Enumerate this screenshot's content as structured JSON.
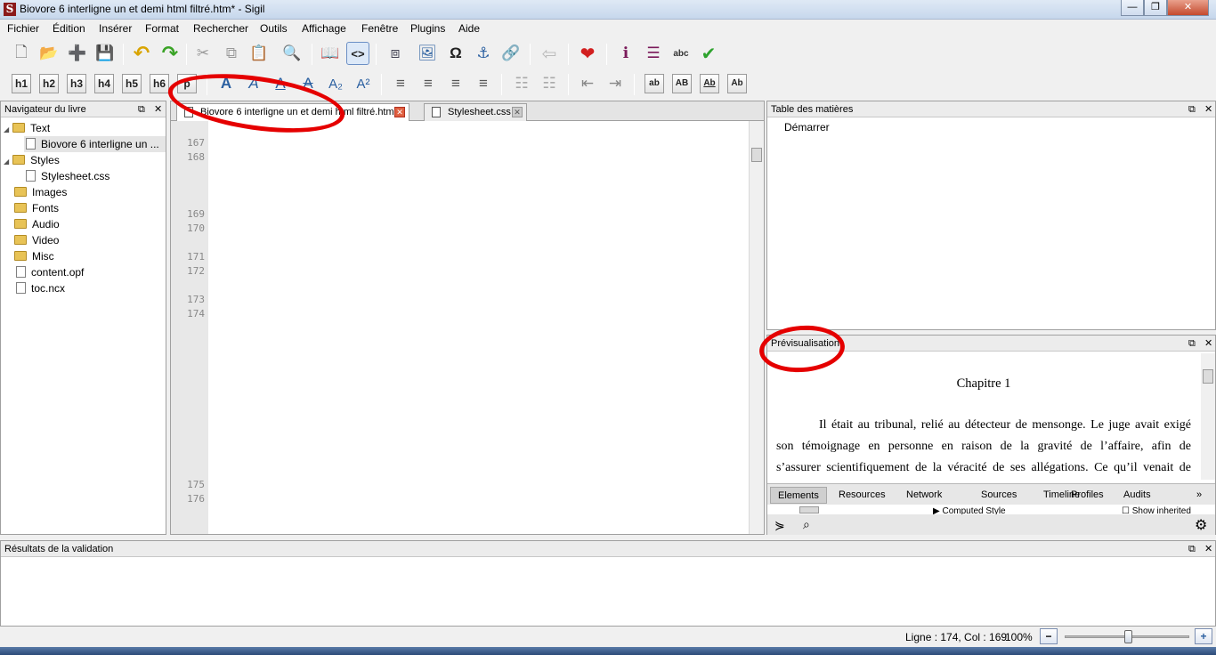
{
  "window": {
    "title": "Biovore 6 interligne un et demi html filtré.htm* - Sigil",
    "app_icon": "S",
    "buttons": {
      "minimize": "—",
      "maximize": "❐",
      "close": "✕"
    }
  },
  "menu": [
    "Fichier",
    "Édition",
    "Insérer",
    "Format",
    "Rechercher",
    "Outils",
    "Affichage",
    "Fenêtre",
    "Plugins",
    "Aide"
  ],
  "toolbar1": [
    {
      "name": "new-file-icon",
      "glyph": "🗋"
    },
    {
      "name": "open-folder-icon",
      "glyph": "📂"
    },
    {
      "name": "add-file-icon",
      "glyph": "➕"
    },
    {
      "name": "save-icon",
      "glyph": "💾"
    },
    {
      "name": "undo-icon",
      "glyph": "↶"
    },
    {
      "name": "redo-icon",
      "glyph": "↷"
    },
    {
      "name": "cut-icon",
      "glyph": "✂"
    },
    {
      "name": "copy-icon",
      "glyph": "⧉"
    },
    {
      "name": "paste-icon",
      "glyph": "📋"
    },
    {
      "name": "find-icon",
      "glyph": "🔍"
    },
    {
      "name": "book-view-icon",
      "glyph": "📖"
    },
    {
      "name": "code-view-icon",
      "glyph": "<>"
    },
    {
      "name": "split-icon",
      "glyph": "⧈"
    },
    {
      "name": "insert-image-icon",
      "glyph": "🖼"
    },
    {
      "name": "omega-icon",
      "glyph": "Ω"
    },
    {
      "name": "anchor-icon",
      "glyph": "⚓"
    },
    {
      "name": "link-icon",
      "glyph": "🔗"
    },
    {
      "name": "back-arrow-icon",
      "glyph": "⇦"
    },
    {
      "name": "heart-icon",
      "glyph": "❤"
    },
    {
      "name": "metadata-icon",
      "glyph": "ℹ"
    },
    {
      "name": "toc-icon",
      "glyph": "☰"
    },
    {
      "name": "spellcheck-icon",
      "glyph": "abc"
    },
    {
      "name": "validate-icon",
      "glyph": "✔"
    }
  ],
  "heading_buttons": [
    "h1",
    "h2",
    "h3",
    "h4",
    "h5",
    "h6",
    "p"
  ],
  "toolbar2": [
    {
      "name": "bold-icon",
      "glyph": "A"
    },
    {
      "name": "italic-icon",
      "glyph": "A"
    },
    {
      "name": "underline-icon",
      "glyph": "A"
    },
    {
      "name": "strike-icon",
      "glyph": "A"
    },
    {
      "name": "subscript-icon",
      "glyph": "A₂"
    },
    {
      "name": "superscript-icon",
      "glyph": "A²"
    },
    {
      "name": "align-left-icon",
      "glyph": "≡"
    },
    {
      "name": "align-center-icon",
      "glyph": "≡"
    },
    {
      "name": "align-right-icon",
      "glyph": "≡"
    },
    {
      "name": "justify-icon",
      "glyph": "≡"
    },
    {
      "name": "bullet-list-icon",
      "glyph": "☷"
    },
    {
      "name": "number-list-icon",
      "glyph": "☷"
    },
    {
      "name": "outdent-icon",
      "glyph": "⇤"
    },
    {
      "name": "indent-icon",
      "glyph": "⇥"
    },
    {
      "name": "lowercase-icon",
      "glyph": "ab"
    },
    {
      "name": "uppercase-icon",
      "glyph": "AB"
    },
    {
      "name": "titlecase-icon",
      "glyph": "Ab"
    },
    {
      "name": "capitalize-icon",
      "glyph": "Ab"
    }
  ],
  "navigator": {
    "title": "Navigateur du livre",
    "items": [
      {
        "label": "Text",
        "type": "folder",
        "expander": "◢"
      },
      {
        "label": "Biovore 6 interligne un ...",
        "type": "file",
        "selected": true
      },
      {
        "label": "Styles",
        "type": "folder",
        "expander": "◢"
      },
      {
        "label": "Stylesheet.css",
        "type": "file"
      },
      {
        "label": "Images",
        "type": "folder"
      },
      {
        "label": "Fonts",
        "type": "folder"
      },
      {
        "label": "Audio",
        "type": "folder"
      },
      {
        "label": "Video",
        "type": "folder"
      },
      {
        "label": "Misc",
        "type": "folder"
      },
      {
        "label": "content.opf",
        "type": "file"
      },
      {
        "label": "toc.ncx",
        "type": "file"
      }
    ]
  },
  "editor": {
    "tabs": [
      {
        "label": "Biovore 6 interligne un et demi html filtré.htm",
        "active": true
      },
      {
        "label": "Stylesheet.css",
        "active": false
      }
    ],
    "line_numbers": [
      "167",
      "168",
      "169",
      "170",
      "171",
      "172",
      "173",
      "174",
      "175",
      "176"
    ]
  },
  "toc": {
    "title": "Table des matières",
    "items": [
      "Démarrer"
    ]
  },
  "preview": {
    "title": "Prévisualisation",
    "heading": "Chapitre 1",
    "lines": [
      "Il était au tribunal, relié au détecteur de mensonge. Le juge avait exigé",
      "son témoignage en personne en raison de la gravité de l’affaire, afin de",
      "s’assurer scientifiquement de la véracité de ses allégations. Ce qu’il venait de"
    ],
    "devtools_tabs": [
      "Elements",
      "Resources",
      "Network",
      "Sources",
      "Timeline",
      "Profiles",
      "Audits"
    ],
    "devtools_more": "»",
    "computed_style": "Computed Style",
    "show_inherited": "Show inherited"
  },
  "validation": {
    "title": "Résultats de la validation"
  },
  "status": {
    "position": "Ligne : 174, Col : 169",
    "zoom": "100%",
    "zoom_level": 0.5
  }
}
